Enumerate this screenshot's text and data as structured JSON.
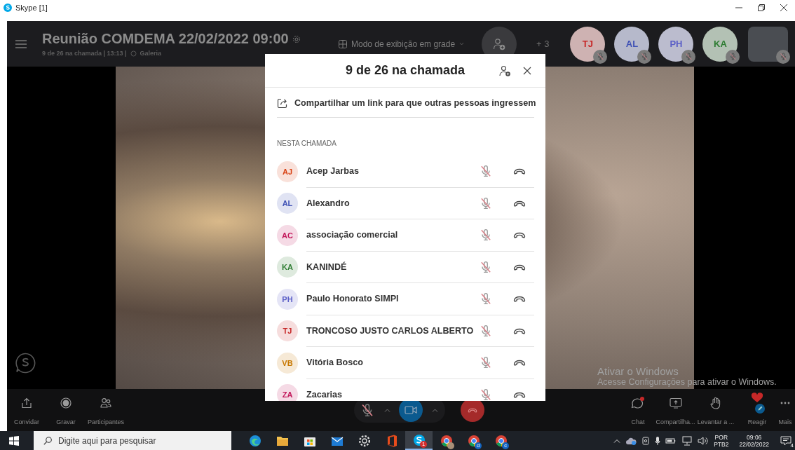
{
  "window": {
    "title": "Skype [1]"
  },
  "header": {
    "title": "Reunião COMDEMA 22/02/2022 09:00",
    "status": "9 de 26 na chamada | 13:13 |",
    "view": "Galeria",
    "grid_mode": "Modo de exibição em grade",
    "overflow": "+ 3",
    "avatars": [
      {
        "kind": "initials",
        "initials": "TJ",
        "color": "#c62828",
        "muted": true
      },
      {
        "kind": "initials",
        "initials": "AL",
        "color": "#3f51b5",
        "muted": true
      },
      {
        "kind": "initials",
        "initials": "PH",
        "color": "#5b5fc7",
        "muted": true
      },
      {
        "kind": "initials",
        "initials": "KA",
        "color": "#2e7d32",
        "muted": true
      },
      {
        "kind": "video",
        "muted": true
      }
    ]
  },
  "panel": {
    "title": "9 de 26 na chamada",
    "share_link": "Compartilhar um link para que outras pessoas ingressem",
    "section": "NESTA CHAMADA",
    "participants": [
      {
        "initials": "AJ",
        "name": "Acep Jarbas",
        "color": "#d84315",
        "muted": true
      },
      {
        "initials": "AL",
        "name": "Alexandro",
        "color": "#3f51b5",
        "muted": true
      },
      {
        "initials": "AC",
        "name": "associação comercial",
        "color": "#c2185b",
        "muted": true
      },
      {
        "initials": "KA",
        "name": "KANINDÉ",
        "color": "#2e7d32",
        "muted": true
      },
      {
        "initials": "PH",
        "name": "Paulo Honorato SIMPI",
        "color": "#5b5fc7",
        "muted": true
      },
      {
        "initials": "TJ",
        "name": "TRONCOSO JUSTO CARLOS ALBERTO",
        "color": "#c62828",
        "muted": true
      },
      {
        "initials": "VB",
        "name": "Vitória Bosco",
        "color": "#c77700",
        "muted": true
      },
      {
        "initials": "ZA",
        "name": "Zacarias",
        "color": "#c2185b",
        "muted": true
      }
    ]
  },
  "call_bar": {
    "left": [
      {
        "kind": "invite",
        "label": "Convidar"
      },
      {
        "kind": "record",
        "label": "Gravar"
      },
      {
        "kind": "participants",
        "label": "Participantes"
      }
    ],
    "mic_muted": true,
    "video_on": true,
    "right": [
      {
        "kind": "chat",
        "label": "Chat"
      },
      {
        "kind": "share",
        "label": "Compartilha..."
      },
      {
        "kind": "hand",
        "label": "Levantar a ..."
      },
      {
        "kind": "react",
        "label": "Reagir"
      },
      {
        "kind": "more",
        "label": "Mais"
      }
    ]
  },
  "activation": {
    "title": "Ativar o Windows",
    "text": "Acesse Configurações para ativar o Windows."
  },
  "taskbar": {
    "search_placeholder": "Digite aqui para pesquisar",
    "apps": [
      {
        "kind": "edge",
        "active": false
      },
      {
        "kind": "folder",
        "active": false
      },
      {
        "kind": "store",
        "active": false
      },
      {
        "kind": "mail",
        "active": false
      },
      {
        "kind": "settings",
        "active": false
      },
      {
        "kind": "office",
        "active": false
      },
      {
        "kind": "skype",
        "active": true,
        "badge": {
          "kind": "count",
          "text": "1"
        }
      },
      {
        "kind": "chrome",
        "active": false,
        "badge": {
          "kind": "avatar"
        }
      },
      {
        "kind": "chrome",
        "active": false,
        "badge": {
          "kind": "letter",
          "text": "d"
        }
      },
      {
        "kind": "chrome",
        "active": false,
        "badge": {
          "kind": "letter",
          "text": "c"
        }
      }
    ],
    "language": "POR",
    "layout": "PTB2",
    "time": "09:06",
    "date": "22/02/2022",
    "notifications": "4"
  }
}
